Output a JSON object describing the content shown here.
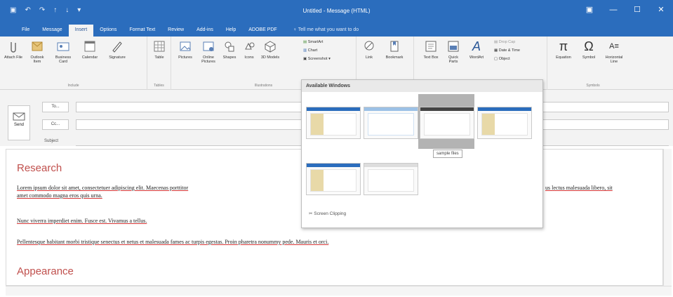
{
  "window": {
    "title": "Untitled - Message (HTML)",
    "controls": [
      "▣",
      "—",
      "☐",
      "✕"
    ]
  },
  "qat_icons": [
    "save-icon",
    "undo-icon",
    "redo-icon",
    "up-icon",
    "down-icon",
    "dropdown-icon"
  ],
  "tabs": [
    "File",
    "Message",
    "Insert",
    "Options",
    "Format Text",
    "Review",
    "Add-ins",
    "Help",
    "ADOBE PDF"
  ],
  "active_tab": "Insert",
  "tell_me": "♀ Tell me what you want to do",
  "ribbon": {
    "include": {
      "label": "Include",
      "buttons": [
        "Attach File",
        "Outlook Item",
        "Business Card",
        "Calendar",
        "Signature"
      ]
    },
    "tables": {
      "label": "Tables",
      "buttons": [
        "Table"
      ]
    },
    "illustrations": {
      "label": "Illustrations",
      "buttons": [
        "Pictures",
        "Online Pictures",
        "Shapes",
        "Icons",
        "3D Models"
      ],
      "small": [
        "SmartArt",
        "Chart",
        "Screenshot"
      ]
    },
    "links": {
      "buttons": [
        "Link",
        "Bookmark"
      ]
    },
    "text": {
      "buttons": [
        "Text Box",
        "Quick Parts",
        "WordArt"
      ],
      "small": [
        "Drop Cap",
        "Date & Time",
        "Object"
      ]
    },
    "symbols": {
      "label": "Symbols",
      "buttons": [
        "Equation",
        "Symbol",
        "Horizontal Line"
      ]
    }
  },
  "message": {
    "send": "Send",
    "to": "To...",
    "cc": "Cc...",
    "subject": "Subject"
  },
  "screenshot_menu": {
    "header": "Available Windows",
    "tooltip": "sample files",
    "clipping": "Screen Clipping"
  },
  "body": {
    "heading1": "Research",
    "para1a": "Lorem ipsum dolor sit amet, consectetuer adipiscing elit. Maecenas porttitor",
    "para1b": "us lectus malesuada libero, sit",
    "para1c": "amet commodo magna eros quis urna.",
    "para2": "Nunc viverra imperdiet enim. Fusce est. Vivamus a tellus.",
    "para3": "Pellentesque habitant morbi tristique senectus et netus et malesuada fames ac turpis egestas. Proin pharetra nonummy pede. Mauris et orci.",
    "heading2": "Appearance"
  }
}
